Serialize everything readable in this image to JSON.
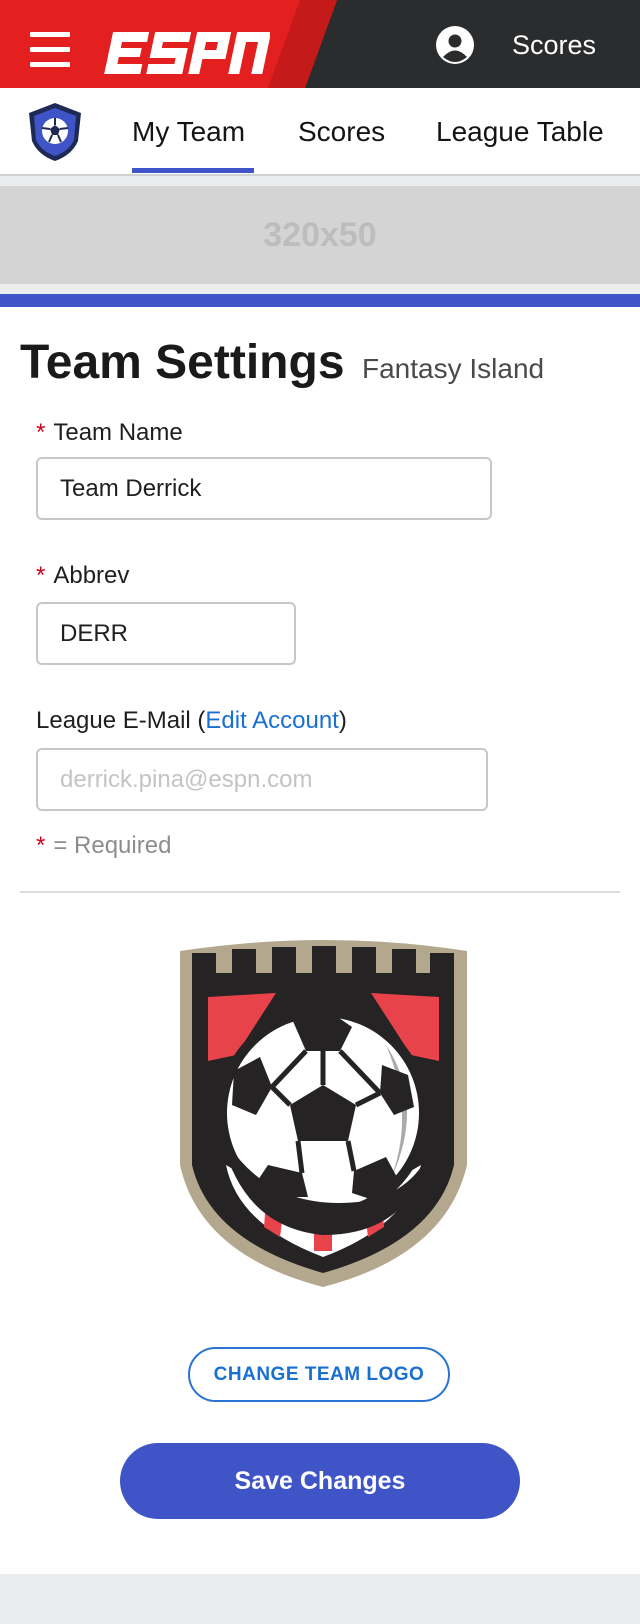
{
  "header": {
    "brand": "ESPN",
    "scores_link": "Scores",
    "colors": {
      "brand_red": "#e41f1f",
      "dark": "#2b2c2d"
    },
    "icons": [
      "hamburger-menu-icon",
      "user-account-icon"
    ]
  },
  "nav": {
    "tabs": [
      {
        "label": "My Team",
        "active": true
      },
      {
        "label": "Scores",
        "active": false
      },
      {
        "label": "League Table",
        "active": false
      }
    ],
    "accent": "#3f55c7",
    "badge_icon": "league-shield-icon"
  },
  "ad": {
    "label": "320x50"
  },
  "settings": {
    "title": "Team Settings",
    "league": "Fantasy Island",
    "required_marker": "*",
    "team_name": {
      "label": "Team Name",
      "value": "Team Derrick"
    },
    "abbrev": {
      "label": "Abbrev",
      "value": "DERR"
    },
    "email": {
      "label_prefix": "League E-Mail (",
      "edit_link": "Edit Account",
      "label_suffix": ")",
      "placeholder": "derrick.pina@espn.com"
    },
    "required_note": "= Required",
    "logo_icon": "soccer-ball-crest-icon",
    "change_logo_button": "CHANGE TEAM LOGO",
    "save_button": "Save Changes"
  }
}
